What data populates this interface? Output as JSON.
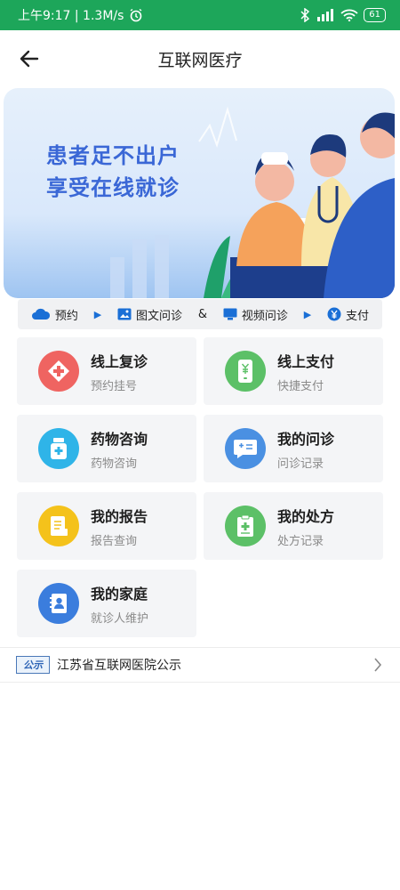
{
  "status_bar": {
    "time_speed": "上午9:17 | 1.3M/s",
    "battery": "61",
    "colors": {
      "background": "#1da65a"
    }
  },
  "header": {
    "title": "互联网医疗",
    "back_icon": "arrow-left-icon"
  },
  "banner": {
    "line1": "患者足不出户",
    "line2": "享受在线就诊"
  },
  "steps": [
    {
      "icon": "cloud-icon",
      "label": "预约"
    },
    {
      "icon": "image-icon",
      "label": "图文问诊"
    },
    {
      "separator": "&"
    },
    {
      "icon": "monitor-icon",
      "label": "视频问诊"
    },
    {
      "icon": "yen-icon",
      "label": "支付"
    }
  ],
  "services": [
    {
      "title": "线上复诊",
      "subtitle": "预约挂号",
      "icon": "medical-cross-icon",
      "color": "#ef6461"
    },
    {
      "title": "线上支付",
      "subtitle": "快捷支付",
      "icon": "payment-phone-icon",
      "color": "#5cc067"
    },
    {
      "title": "药物咨询",
      "subtitle": "药物咨询",
      "icon": "medicine-bottle-icon",
      "color": "#2fb4e8"
    },
    {
      "title": "我的问诊",
      "subtitle": "问诊记录",
      "icon": "chat-icon",
      "color": "#4a90e2"
    },
    {
      "title": "我的报告",
      "subtitle": "报告查询",
      "icon": "report-icon",
      "color": "#f4c21b"
    },
    {
      "title": "我的处方",
      "subtitle": "处方记录",
      "icon": "prescription-icon",
      "color": "#5cc067"
    },
    {
      "title": "我的家庭",
      "subtitle": "就诊人维护",
      "icon": "family-contact-icon",
      "color": "#3b7ddd"
    }
  ],
  "notice": {
    "badge": "公示",
    "text": "江苏省互联网医院公示"
  }
}
